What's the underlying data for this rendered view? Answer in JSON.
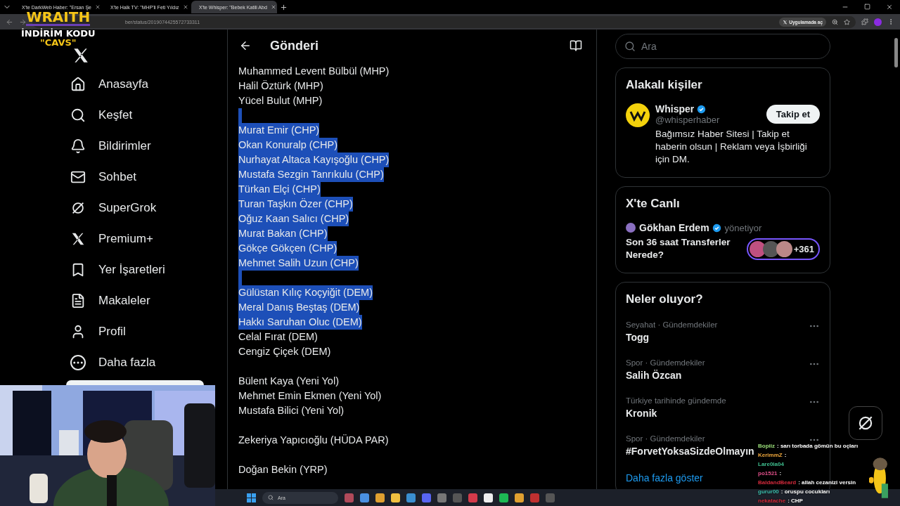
{
  "browser": {
    "tabs": [
      {
        "title": "X'te DarkWeb Haber: \"Ersan Şe",
        "selected": false
      },
      {
        "title": "X'te Halk TV: \"MHP'li Feti Yıldız",
        "selected": false
      },
      {
        "title": "X'te Whisper: \"Bebek Katili Abd",
        "selected": true
      }
    ],
    "url": "ber/status/2019074425572733311",
    "open_in_app": "Uygulamada aç"
  },
  "promo": {
    "brand": "WRAITH",
    "line": "İNDİRİM KODU",
    "code": "\"CAVS\""
  },
  "sidebar": {
    "items": [
      {
        "label": "Anasayfa",
        "kind": "home"
      },
      {
        "label": "Keşfet",
        "kind": "search"
      },
      {
        "label": "Bildirimler",
        "kind": "bell"
      },
      {
        "label": "Sohbet",
        "kind": "mail"
      },
      {
        "label": "SuperGrok",
        "kind": "grok"
      },
      {
        "label": "Premium+",
        "kind": "x"
      },
      {
        "label": "Yer İşaretleri",
        "kind": "bookmark"
      },
      {
        "label": "Makaleler",
        "kind": "article"
      },
      {
        "label": "Profil",
        "kind": "person"
      },
      {
        "label": "Daha fazla",
        "kind": "more"
      }
    ]
  },
  "post": {
    "title": "Gönderi",
    "lines": [
      {
        "kind": "text",
        "text": "Muhammed Levent Bülbül (MHP)",
        "selected": false
      },
      {
        "kind": "text",
        "text": "Halil Öztürk (MHP)",
        "selected": false
      },
      {
        "kind": "text",
        "text": "Yücel Bulut (MHP)",
        "selected": false
      },
      {
        "kind": "gap",
        "selected": true
      },
      {
        "kind": "text",
        "text": "Murat Emir (CHP)",
        "selected": true
      },
      {
        "kind": "text",
        "text": "Okan Konuralp (CHP)",
        "selected": true
      },
      {
        "kind": "text",
        "text": "Nurhayat Altaca Kayışoğlu (CHP)",
        "selected": true
      },
      {
        "kind": "text",
        "text": "Mustafa Sezgin Tanrıkulu (CHP)",
        "selected": true
      },
      {
        "kind": "text",
        "text": "Türkan Elçi (CHP)",
        "selected": true
      },
      {
        "kind": "text",
        "text": "Turan Taşkın Özer (CHP)",
        "selected": true
      },
      {
        "kind": "text",
        "text": "Oğuz Kaan Salıcı (CHP)",
        "selected": true
      },
      {
        "kind": "text",
        "text": "Murat Bakan (CHP)",
        "selected": true
      },
      {
        "kind": "text",
        "text": "Gökçe Gökçen (CHP)",
        "selected": true
      },
      {
        "kind": "text",
        "text": "Mehmet Salih Uzun (CHP)",
        "selected": true
      },
      {
        "kind": "gap",
        "selected": true
      },
      {
        "kind": "text",
        "text": "Gülüstan Kılıç Koçyiğit (DEM)",
        "selected": true
      },
      {
        "kind": "text",
        "text": "Meral Danış Beştaş (DEM)",
        "selected": true
      },
      {
        "kind": "text",
        "text": "Hakkı Saruhan Oluc (DEM)",
        "selected": true
      },
      {
        "kind": "text",
        "text": "Celal Fırat (DEM)",
        "selected": false
      },
      {
        "kind": "text",
        "text": "Cengiz Çiçek (DEM)",
        "selected": false
      },
      {
        "kind": "gap",
        "selected": false
      },
      {
        "kind": "text",
        "text": "Bülent Kaya (Yeni Yol)",
        "selected": false
      },
      {
        "kind": "text",
        "text": "Mehmet Emin Ekmen (Yeni Yol)",
        "selected": false
      },
      {
        "kind": "text",
        "text": "Mustafa Bilici (Yeni Yol)",
        "selected": false
      },
      {
        "kind": "gap",
        "selected": false
      },
      {
        "kind": "text",
        "text": "Zekeriya Yapıcıoğlu (HÜDA PAR)",
        "selected": false
      },
      {
        "kind": "gap",
        "selected": false
      },
      {
        "kind": "text",
        "text": "Doğan Bekin (YRP)",
        "selected": false
      }
    ]
  },
  "search": {
    "placeholder": "Ara"
  },
  "related": {
    "title": "Alakalı kişiler",
    "name": "Whisper",
    "handle": "@whisperhaber",
    "bio": "Bağımsız Haber Sitesi | Takip et haberin olsun | Reklam veya İşbirliği için DM.",
    "button": "Takip et"
  },
  "live": {
    "title": "X'te Canlı",
    "host": "Gökhan Erdem",
    "role": "yönetiyor",
    "topic": "Son 36 saat Transferler Nerede?",
    "count": "+361"
  },
  "trends": {
    "title": "Neler oluyor?",
    "items": [
      {
        "category": "Seyahat · Gündemdekiler",
        "topic": "Togg"
      },
      {
        "category": "Spor · Gündemdekiler",
        "topic": "Salih Özcan"
      },
      {
        "category": "Türkiye tarihinde gündemde",
        "topic": "Kronik"
      },
      {
        "category": "Spor · Gündemdekiler",
        "topic": "#ForvetYoksaSizdeOlmayın"
      }
    ],
    "more": "Daha fazla göster"
  },
  "chat": [
    {
      "user": "Bopiiz",
      "message": ": sarı torbada gömün bu oçları",
      "color": "#9be07a"
    },
    {
      "user": "KerimmZ",
      "message": ":",
      "color": "#f0a83c"
    },
    {
      "user": "Lare0la04",
      "color": "#3fbf8f"
    },
    {
      "user": "po1521",
      "message": ":",
      "color": "#e0508a"
    },
    {
      "user": "BaldandBeard",
      "message": ": allah cezanizi versin",
      "color": "#d42a3c"
    },
    {
      "user": "gurur00",
      "message": ": oruspu cocukları",
      "color": "#3fc0b0"
    },
    {
      "user": "nekatache",
      "message": ": CHP",
      "color": "#d42a3c"
    }
  ],
  "taskbar": {
    "search_placeholder": "Ara"
  }
}
